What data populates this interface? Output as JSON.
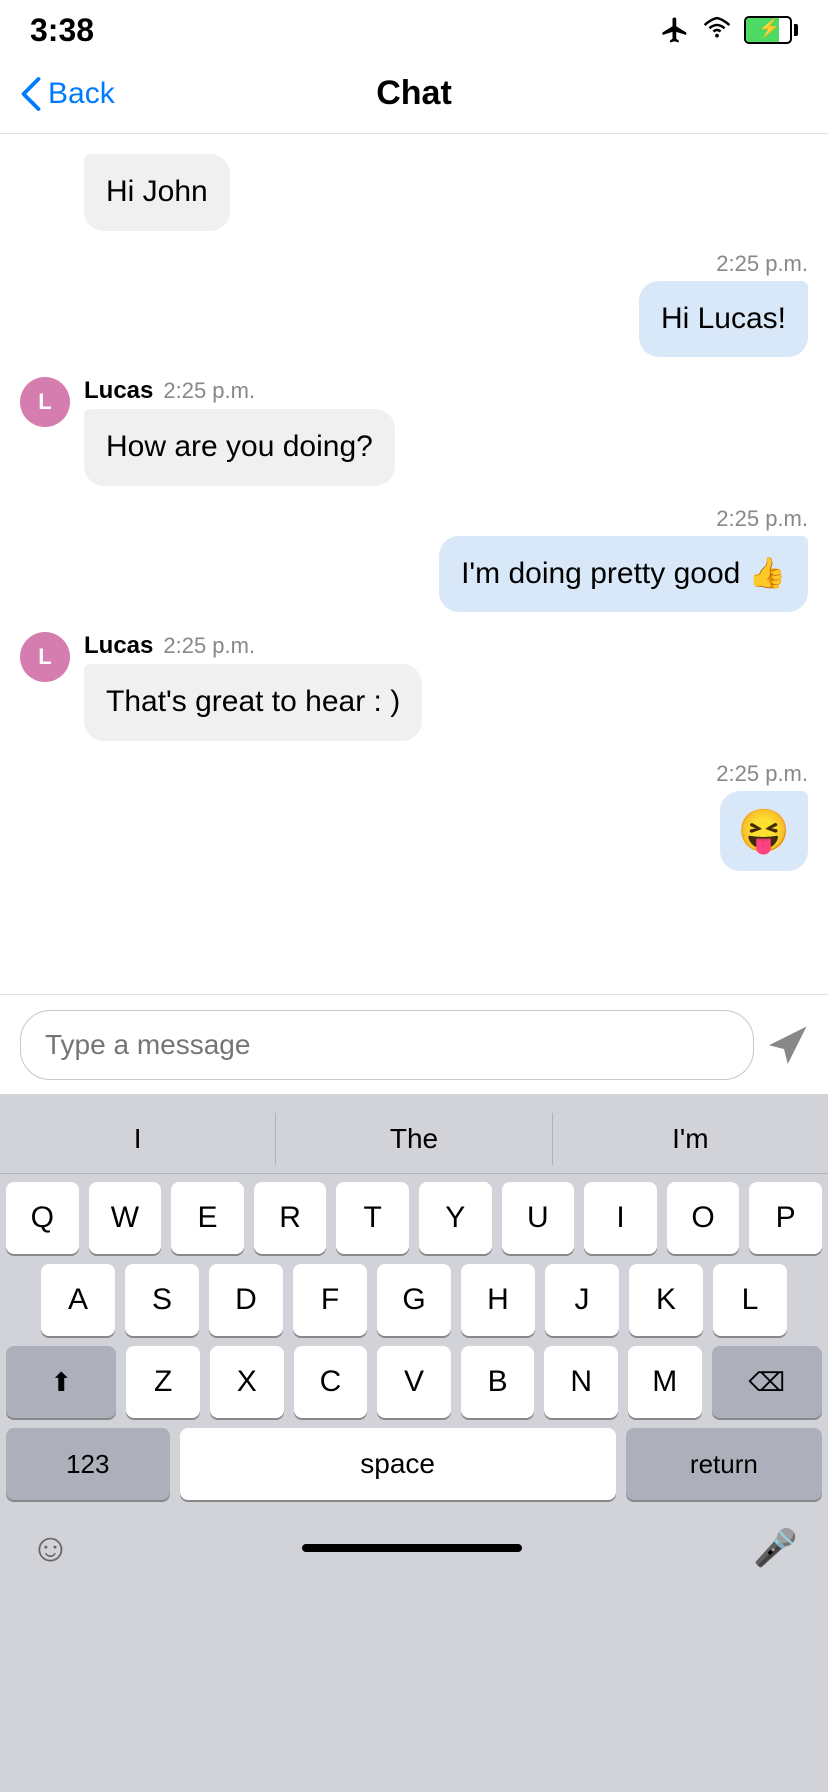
{
  "statusBar": {
    "time": "3:38"
  },
  "navBar": {
    "backLabel": "Back",
    "title": "Chat"
  },
  "messages": [
    {
      "id": "msg1",
      "type": "received-no-avatar",
      "text": "Hi John",
      "time": "",
      "sender": ""
    },
    {
      "id": "msg2",
      "type": "sent",
      "text": "Hi Lucas!",
      "time": "2:25 p.m."
    },
    {
      "id": "msg3",
      "type": "received",
      "text": "How are you doing?",
      "time": "2:25 p.m.",
      "sender": "Lucas",
      "avatarLabel": "L"
    },
    {
      "id": "msg4",
      "type": "sent",
      "text": "I'm doing pretty good 👍",
      "time": "2:25 p.m."
    },
    {
      "id": "msg5",
      "type": "received",
      "text": "That's great to hear : )",
      "time": "2:25 p.m.",
      "sender": "Lucas",
      "avatarLabel": "L"
    },
    {
      "id": "msg6",
      "type": "sent",
      "text": "😝",
      "time": "2:25 p.m."
    }
  ],
  "inputArea": {
    "placeholder": "Type a message",
    "sendIcon": "▶"
  },
  "autocomplete": {
    "items": [
      "I",
      "The",
      "I'm"
    ]
  },
  "keyboard": {
    "rows": [
      [
        "Q",
        "W",
        "E",
        "R",
        "T",
        "Y",
        "U",
        "I",
        "O",
        "P"
      ],
      [
        "A",
        "S",
        "D",
        "F",
        "G",
        "H",
        "J",
        "K",
        "L"
      ],
      [
        "⬆",
        "Z",
        "X",
        "C",
        "V",
        "B",
        "N",
        "M",
        "⌫"
      ],
      [
        "123",
        "space",
        "return"
      ]
    ]
  },
  "bottomBar": {
    "emojiIcon": "😊",
    "micIcon": "🎤"
  }
}
